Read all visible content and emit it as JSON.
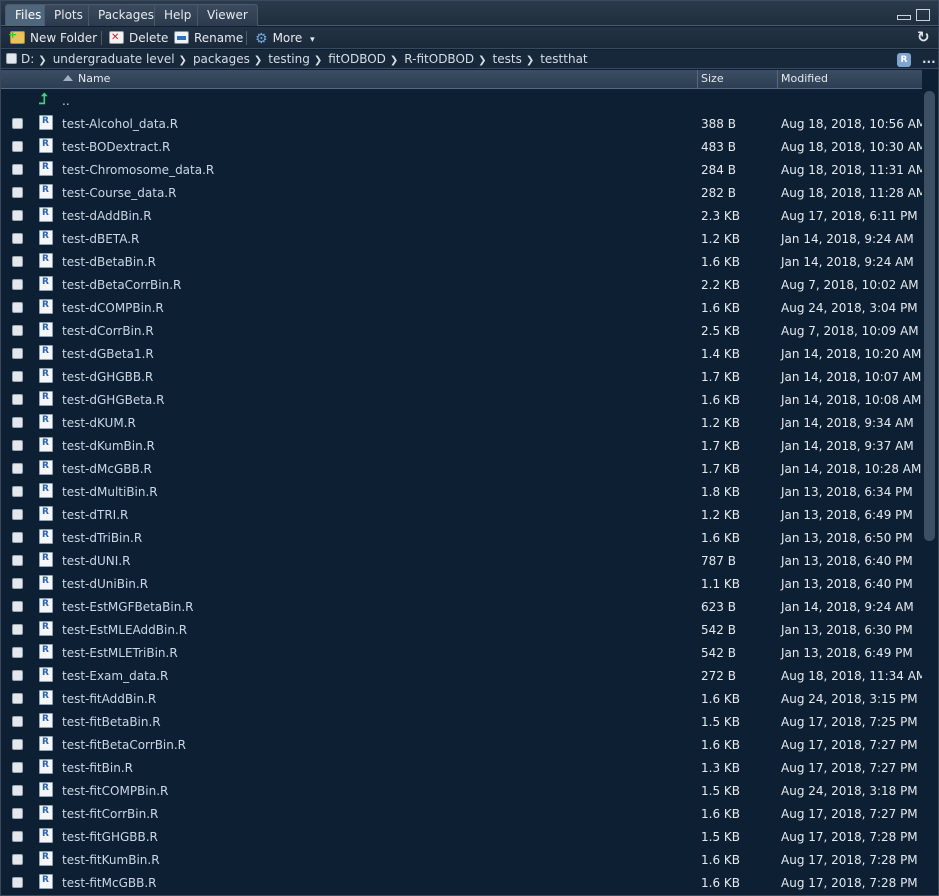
{
  "tabs": [
    {
      "label": "Files",
      "active": true
    },
    {
      "label": "Plots",
      "active": false
    },
    {
      "label": "Packages",
      "active": false
    },
    {
      "label": "Help",
      "active": false
    },
    {
      "label": "Viewer",
      "active": false
    }
  ],
  "toolbar": {
    "new_folder": "New Folder",
    "delete": "Delete",
    "rename": "Rename",
    "more": "More",
    "more_caret": "▾",
    "refresh_icon": "refresh-icon"
  },
  "breadcrumb": [
    "D:",
    "undergraduate level",
    "packages",
    "testing",
    "fitODBOD",
    "R-fitODBOD",
    "tests",
    "testthat"
  ],
  "breadcrumb_separator": "❯",
  "breadcrumb_more": "...",
  "r_project_icon": "R",
  "columns": {
    "name": "Name",
    "size": "Size",
    "modified": "Modified"
  },
  "parent_dir": "..",
  "files": [
    {
      "name": "test-Alcohol_data.R",
      "size": "388 B",
      "modified": "Aug 18, 2018, 10:56 AM"
    },
    {
      "name": "test-BODextract.R",
      "size": "483 B",
      "modified": "Aug 18, 2018, 10:30 AM"
    },
    {
      "name": "test-Chromosome_data.R",
      "size": "284 B",
      "modified": "Aug 18, 2018, 11:31 AM"
    },
    {
      "name": "test-Course_data.R",
      "size": "282 B",
      "modified": "Aug 18, 2018, 11:28 AM"
    },
    {
      "name": "test-dAddBin.R",
      "size": "2.3 KB",
      "modified": "Aug 17, 2018, 6:11 PM"
    },
    {
      "name": "test-dBETA.R",
      "size": "1.2 KB",
      "modified": "Jan 14, 2018, 9:24 AM"
    },
    {
      "name": "test-dBetaBin.R",
      "size": "1.6 KB",
      "modified": "Jan 14, 2018, 9:24 AM"
    },
    {
      "name": "test-dBetaCorrBin.R",
      "size": "2.2 KB",
      "modified": "Aug 7, 2018, 10:02 AM"
    },
    {
      "name": "test-dCOMPBin.R",
      "size": "1.6 KB",
      "modified": "Aug 24, 2018, 3:04 PM"
    },
    {
      "name": "test-dCorrBin.R",
      "size": "2.5 KB",
      "modified": "Aug 7, 2018, 10:09 AM"
    },
    {
      "name": "test-dGBeta1.R",
      "size": "1.4 KB",
      "modified": "Jan 14, 2018, 10:20 AM"
    },
    {
      "name": "test-dGHGBB.R",
      "size": "1.7 KB",
      "modified": "Jan 14, 2018, 10:07 AM"
    },
    {
      "name": "test-dGHGBeta.R",
      "size": "1.6 KB",
      "modified": "Jan 14, 2018, 10:08 AM"
    },
    {
      "name": "test-dKUM.R",
      "size": "1.2 KB",
      "modified": "Jan 14, 2018, 9:34 AM"
    },
    {
      "name": "test-dKumBin.R",
      "size": "1.7 KB",
      "modified": "Jan 14, 2018, 9:37 AM"
    },
    {
      "name": "test-dMcGBB.R",
      "size": "1.7 KB",
      "modified": "Jan 14, 2018, 10:28 AM"
    },
    {
      "name": "test-dMultiBin.R",
      "size": "1.8 KB",
      "modified": "Jan 13, 2018, 6:34 PM"
    },
    {
      "name": "test-dTRI.R",
      "size": "1.2 KB",
      "modified": "Jan 13, 2018, 6:49 PM"
    },
    {
      "name": "test-dTriBin.R",
      "size": "1.6 KB",
      "modified": "Jan 13, 2018, 6:50 PM"
    },
    {
      "name": "test-dUNI.R",
      "size": "787 B",
      "modified": "Jan 13, 2018, 6:40 PM"
    },
    {
      "name": "test-dUniBin.R",
      "size": "1.1 KB",
      "modified": "Jan 13, 2018, 6:40 PM"
    },
    {
      "name": "test-EstMGFBetaBin.R",
      "size": "623 B",
      "modified": "Jan 14, 2018, 9:24 AM"
    },
    {
      "name": "test-EstMLEAddBin.R",
      "size": "542 B",
      "modified": "Jan 13, 2018, 6:30 PM"
    },
    {
      "name": "test-EstMLETriBin.R",
      "size": "542 B",
      "modified": "Jan 13, 2018, 6:49 PM"
    },
    {
      "name": "test-Exam_data.R",
      "size": "272 B",
      "modified": "Aug 18, 2018, 11:34 AM"
    },
    {
      "name": "test-fitAddBin.R",
      "size": "1.6 KB",
      "modified": "Aug 24, 2018, 3:15 PM"
    },
    {
      "name": "test-fitBetaBin.R",
      "size": "1.5 KB",
      "modified": "Aug 17, 2018, 7:25 PM"
    },
    {
      "name": "test-fitBetaCorrBin.R",
      "size": "1.6 KB",
      "modified": "Aug 17, 2018, 7:27 PM"
    },
    {
      "name": "test-fitBin.R",
      "size": "1.3 KB",
      "modified": "Aug 17, 2018, 7:27 PM"
    },
    {
      "name": "test-fitCOMPBin.R",
      "size": "1.5 KB",
      "modified": "Aug 24, 2018, 3:18 PM"
    },
    {
      "name": "test-fitCorrBin.R",
      "size": "1.6 KB",
      "modified": "Aug 17, 2018, 7:27 PM"
    },
    {
      "name": "test-fitGHGBB.R",
      "size": "1.5 KB",
      "modified": "Aug 17, 2018, 7:28 PM"
    },
    {
      "name": "test-fitKumBin.R",
      "size": "1.6 KB",
      "modified": "Aug 17, 2018, 7:28 PM"
    },
    {
      "name": "test-fitMcGBB.R",
      "size": "1.6 KB",
      "modified": "Aug 17, 2018, 7:28 PM"
    }
  ]
}
